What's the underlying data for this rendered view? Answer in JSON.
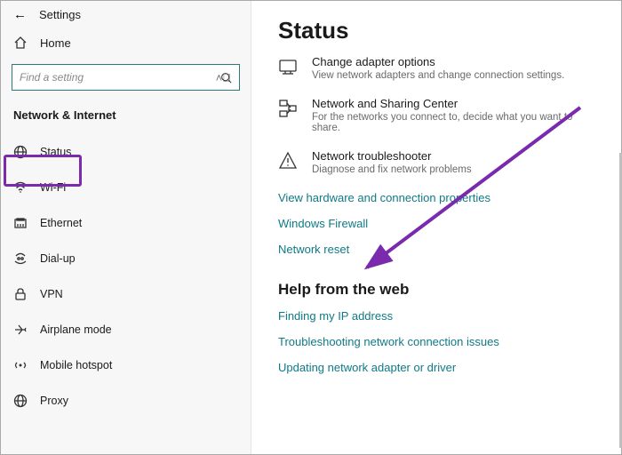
{
  "app_title": "Settings",
  "home_label": "Home",
  "search_placeholder": "Find a setting",
  "section_header": "Network & Internet",
  "nav": [
    {
      "id": "status",
      "label": "Status",
      "selected": true
    },
    {
      "id": "wifi",
      "label": "Wi-Fi"
    },
    {
      "id": "ethernet",
      "label": "Ethernet"
    },
    {
      "id": "dialup",
      "label": "Dial-up"
    },
    {
      "id": "vpn",
      "label": "VPN"
    },
    {
      "id": "airplane",
      "label": "Airplane mode"
    },
    {
      "id": "hotspot",
      "label": "Mobile hotspot"
    },
    {
      "id": "proxy",
      "label": "Proxy"
    }
  ],
  "page_title": "Status",
  "options": [
    {
      "id": "adapter",
      "title": "Change adapter options",
      "desc": "View network adapters and change connection settings."
    },
    {
      "id": "sharing",
      "title": "Network and Sharing Center",
      "desc": "For the networks you connect to, decide what you want to share."
    },
    {
      "id": "trouble",
      "title": "Network troubleshooter",
      "desc": "Diagnose and fix network problems"
    }
  ],
  "links": {
    "hwprops": "View hardware and connection properties",
    "firewall": "Windows Firewall",
    "reset": "Network reset"
  },
  "help_header": "Help from the web",
  "help_links": {
    "ip": "Finding my IP address",
    "tshoot": "Troubleshooting network connection issues",
    "update": "Updating network adapter or driver"
  }
}
